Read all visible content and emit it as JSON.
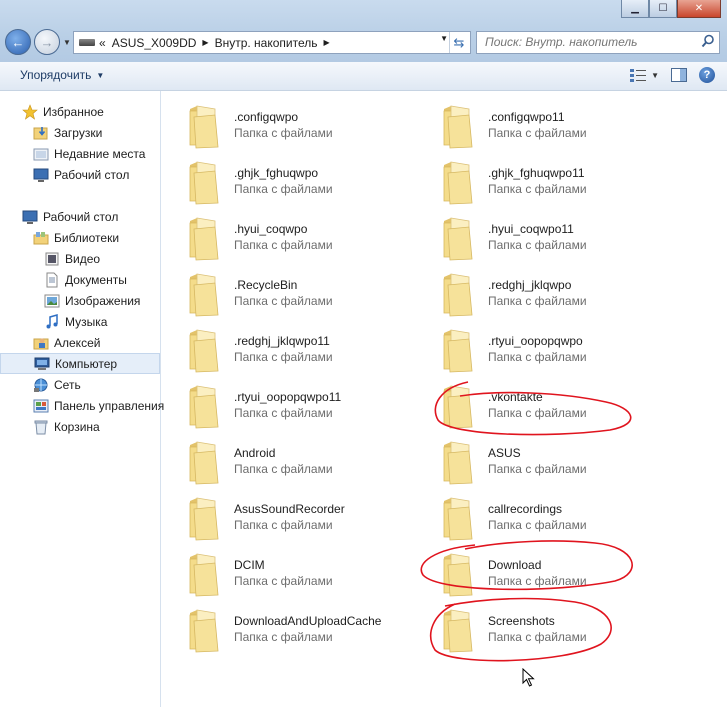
{
  "address_bar": {
    "overflow": "«",
    "crumbs": [
      "ASUS_X009DD",
      "Внутр. накопитель"
    ]
  },
  "search": {
    "placeholder": "Поиск: Внутр. накопитель"
  },
  "toolbar": {
    "organize_label": "Упорядочить"
  },
  "sidebar": {
    "favorites": {
      "label": "Избранное",
      "items": [
        {
          "label": "Загрузки",
          "icon": "downloads-icon"
        },
        {
          "label": "Недавние места",
          "icon": "recent-places-icon"
        },
        {
          "label": "Рабочий стол",
          "icon": "desktop-icon"
        }
      ]
    },
    "desktop": {
      "label": "Рабочий стол"
    },
    "libraries": {
      "label": "Библиотеки",
      "items": [
        {
          "label": "Видео",
          "icon": "video-icon"
        },
        {
          "label": "Документы",
          "icon": "documents-icon"
        },
        {
          "label": "Изображения",
          "icon": "pictures-icon"
        },
        {
          "label": "Музыка",
          "icon": "music-icon"
        }
      ]
    },
    "tail": [
      {
        "label": "Алексей",
        "icon": "user-folder-icon"
      },
      {
        "label": "Компьютер",
        "icon": "computer-icon",
        "selected": true
      },
      {
        "label": "Сеть",
        "icon": "network-icon"
      },
      {
        "label": "Панель управления",
        "icon": "control-panel-icon"
      },
      {
        "label": "Корзина",
        "icon": "recycle-bin-icon"
      }
    ]
  },
  "folder_type": "Папка с файлами",
  "folders_left": [
    ".configqwpo",
    ".ghjk_fghuqwpo",
    ".hyui_coqwpo",
    ".RecycleBin",
    ".redghj_jklqwpo11",
    ".rtyui_oopopqwpo11",
    "Android",
    "AsusSoundRecorder",
    "DCIM",
    "DownloadAndUploadCache"
  ],
  "folders_right": [
    ".configqwpo11",
    ".ghjk_fghuqwpo11",
    ".hyui_coqwpo11",
    ".redghj_jklqwpo",
    ".rtyui_oopopqwpo",
    ".vkontakte",
    "ASUS",
    "callrecordings",
    "Download",
    "Screenshots"
  ],
  "colors": {
    "annotation": "#e0141e",
    "window_frame": "#b9cfe6",
    "selection": "#e5eef9"
  }
}
